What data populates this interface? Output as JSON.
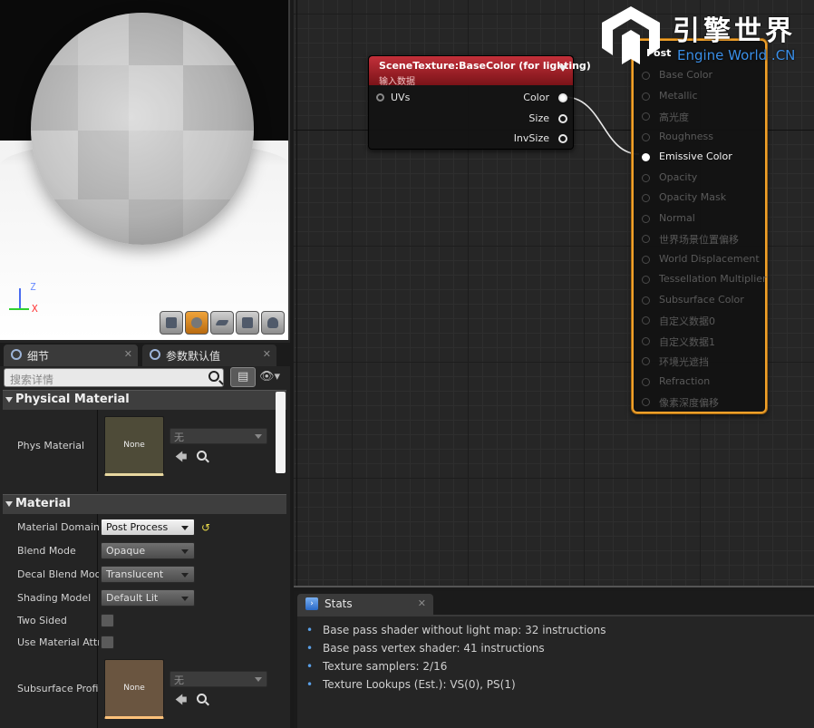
{
  "viewport": {
    "axis_z": "Z",
    "axis_x": "X",
    "toolbar": [
      {
        "name": "cylinder-preview-icon"
      },
      {
        "name": "sphere-preview-icon",
        "active": true
      },
      {
        "name": "plane-preview-icon"
      },
      {
        "name": "cube-preview-icon"
      },
      {
        "name": "teapot-preview-icon"
      }
    ]
  },
  "details": {
    "tabs": [
      {
        "label": "细节",
        "close": "✕"
      },
      {
        "label": "参数默认值",
        "close": "✕"
      }
    ],
    "search_placeholder": "搜索详情",
    "physical_section": {
      "title": "Physical Material",
      "phys_material_label": "Phys Material",
      "thumb_label": "None",
      "asset_value": "无"
    },
    "material_section": {
      "title": "Material",
      "rows": [
        {
          "label": "Material Domain",
          "value": "Post Process"
        },
        {
          "label": "Blend Mode",
          "value": "Opaque"
        },
        {
          "label": "Decal Blend Mode",
          "value": "Translucent"
        },
        {
          "label": "Shading Model",
          "value": "Default Lit"
        },
        {
          "label": "Two Sided",
          "value": ""
        },
        {
          "label": "Use Material Attributes",
          "value": ""
        },
        {
          "label": "Subsurface Profile",
          "value": ""
        }
      ],
      "subsurface_thumb_label": "None",
      "subsurface_asset_value": "无",
      "reset_icon": "↺"
    }
  },
  "graph": {
    "scene_texture_node": {
      "title": "SceneTexture:BaseColor (for lighting)",
      "subtitle": "输入数据",
      "input_uvs": "UVs",
      "output_color": "Color",
      "output_size": "Size",
      "output_invsize": "InvSize"
    },
    "result_node": {
      "title": "Post",
      "pins": [
        {
          "label": "Base Color",
          "active": false
        },
        {
          "label": "Metallic",
          "active": false
        },
        {
          "label": "高光度",
          "active": false
        },
        {
          "label": "Roughness",
          "active": false
        },
        {
          "label": "Emissive Color",
          "active": true
        },
        {
          "label": "Opacity",
          "active": false
        },
        {
          "label": "Opacity Mask",
          "active": false
        },
        {
          "label": "Normal",
          "active": false
        },
        {
          "label": "世界场景位置偏移",
          "active": false
        },
        {
          "label": "World Displacement",
          "active": false
        },
        {
          "label": "Tessellation Multiplier",
          "active": false
        },
        {
          "label": "Subsurface Color",
          "active": false
        },
        {
          "label": "自定义数据0",
          "active": false
        },
        {
          "label": "自定义数据1",
          "active": false
        },
        {
          "label": "环境光遮挡",
          "active": false
        },
        {
          "label": "Refraction",
          "active": false
        },
        {
          "label": "像素深度偏移",
          "active": false
        }
      ]
    },
    "logo": {
      "cn": "引擎世界",
      "en": "Engine World .CN"
    }
  },
  "stats": {
    "tab_label": "Stats",
    "tab_close": "✕",
    "lines": [
      "Base pass shader without light map: 32 instructions",
      "Base pass vertex shader: 41 instructions",
      "Texture samplers: 2/16",
      "Texture Lookups (Est.): VS(0), PS(1)"
    ]
  },
  "colors": {
    "node_header": "#b0242c",
    "result_border": "#f0a02a",
    "logo_en": "#3a8fe8",
    "stat_bullet": "#5aa0e8"
  }
}
